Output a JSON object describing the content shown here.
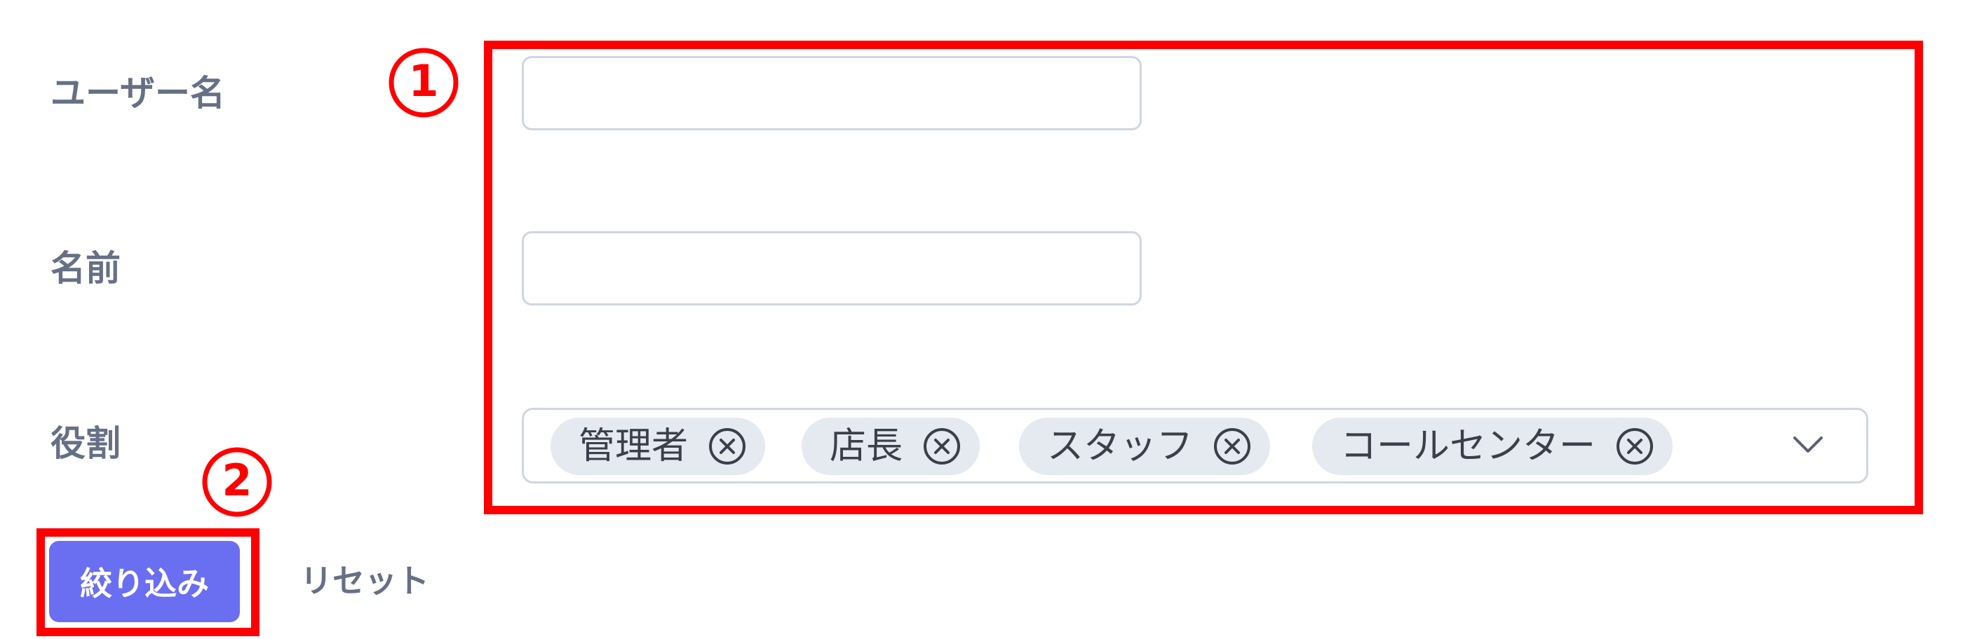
{
  "form": {
    "username": {
      "label": "ユーザー名",
      "value": "",
      "placeholder": ""
    },
    "name": {
      "label": "名前",
      "value": "",
      "placeholder": ""
    },
    "role": {
      "label": "役割",
      "tags": [
        {
          "label": "管理者"
        },
        {
          "label": "店長"
        },
        {
          "label": "スタッフ"
        },
        {
          "label": "コールセンター"
        }
      ],
      "dropdown_icon": "chevron-down-icon",
      "tag_remove_icon": "circle-x-icon"
    }
  },
  "actions": {
    "filter_label": "絞り込み",
    "reset_label": "リセット"
  },
  "annotations": {
    "marker_1": "①",
    "marker_2": "②",
    "highlight_color": "#ff0000"
  },
  "colors": {
    "primary_button": "#6a6ef0",
    "label_text": "#667085",
    "tag_background": "#e5e9f0",
    "input_border": "#cfd6e1"
  }
}
